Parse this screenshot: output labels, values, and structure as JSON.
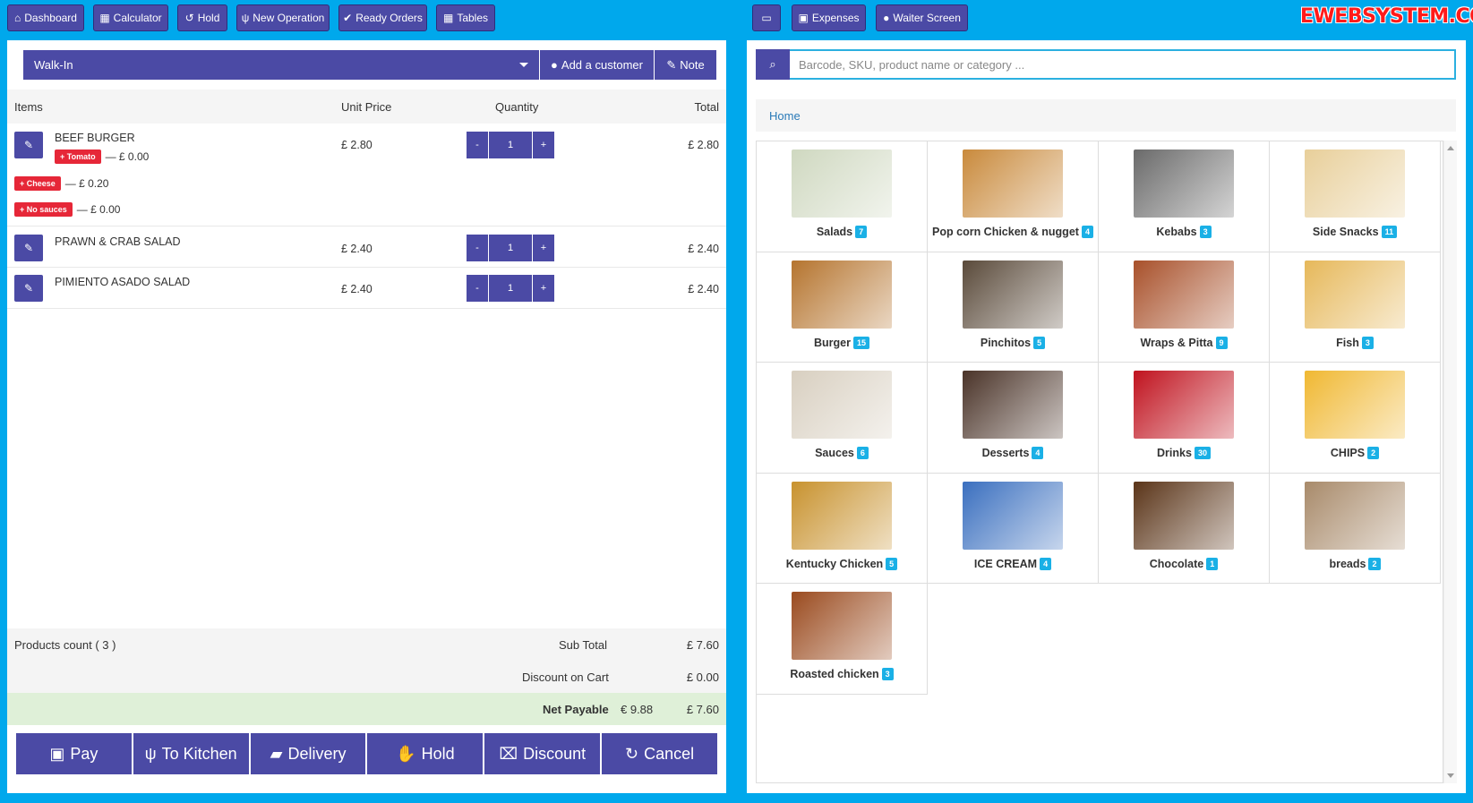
{
  "toolbar": {
    "dashboard": "Dashboard",
    "calculator": "Calculator",
    "hold": "Hold",
    "new_operation": "New Operation",
    "ready_orders": "Ready Orders",
    "tables": "Tables",
    "expenses": "Expenses",
    "waiter_screen": "Waiter Screen"
  },
  "brand": "EWEBSYSTEM.COM",
  "customer": {
    "selected": "Walk-In",
    "add_label": "Add a customer",
    "note_label": "Note"
  },
  "cart": {
    "headers": {
      "items": "Items",
      "unit_price": "Unit Price",
      "quantity": "Quantity",
      "total": "Total"
    },
    "items": [
      {
        "name": "BEEF BURGER",
        "unit_price": "£ 2.80",
        "qty": "1",
        "total": "£ 2.80",
        "modifiers": [
          {
            "label": "+ Tomato",
            "price": "— £ 0.00"
          },
          {
            "label": "+ Cheese",
            "price": "— £ 0.20"
          },
          {
            "label": "+ No sauces",
            "price": "— £ 0.00"
          }
        ]
      },
      {
        "name": "PRAWN & CRAB SALAD",
        "unit_price": "£ 2.40",
        "qty": "1",
        "total": "£ 2.40"
      },
      {
        "name": "PIMIENTO ASADO SALAD",
        "unit_price": "£ 2.40",
        "qty": "1",
        "total": "£ 2.40"
      }
    ],
    "minus": "-",
    "plus": "+"
  },
  "summary": {
    "products_count": "Products count ( 3 )",
    "subtotal_label": "Sub Total",
    "subtotal": "£ 7.60",
    "discount_label": "Discount on Cart",
    "discount": "£ 0.00",
    "net_label": "Net Payable",
    "net_eur": "€ 9.88",
    "net": "£ 7.60"
  },
  "actions": {
    "pay": "Pay",
    "kitchen": "To Kitchen",
    "delivery": "Delivery",
    "hold": "Hold",
    "discount": "Discount",
    "cancel": "Cancel"
  },
  "search": {
    "placeholder": "Barcode, SKU, product name or category ..."
  },
  "breadcrumb": "Home",
  "categories": [
    {
      "name": "Salads",
      "count": "7",
      "color": "#cfd8c0"
    },
    {
      "name": "Pop corn Chicken & nugget",
      "count": "4",
      "color": "#c98a3c"
    },
    {
      "name": "Kebabs",
      "count": "3",
      "color": "#6a6a6a"
    },
    {
      "name": "Side Snacks",
      "count": "11",
      "color": "#e8cf9a"
    },
    {
      "name": "Burger",
      "count": "15",
      "color": "#b5742e"
    },
    {
      "name": "Pinchitos",
      "count": "5",
      "color": "#5a4a3a"
    },
    {
      "name": "Wraps & Pitta",
      "count": "9",
      "color": "#a8502a"
    },
    {
      "name": "Fish",
      "count": "3",
      "color": "#e6b85a"
    },
    {
      "name": "Sauces",
      "count": "6",
      "color": "#d8cfc0"
    },
    {
      "name": "Desserts",
      "count": "4",
      "color": "#4a3328"
    },
    {
      "name": "Drinks",
      "count": "30",
      "color": "#c0121e"
    },
    {
      "name": "CHIPS",
      "count": "2",
      "color": "#f0b832"
    },
    {
      "name": "Kentucky Chicken",
      "count": "5",
      "color": "#c8922e"
    },
    {
      "name": "ICE CREAM",
      "count": "4",
      "color": "#3a6fbf"
    },
    {
      "name": "Chocolate",
      "count": "1",
      "color": "#5a3418"
    },
    {
      "name": "breads",
      "count": "2",
      "color": "#a88a6a"
    },
    {
      "name": "Roasted chicken",
      "count": "3",
      "color": "#9a4a1e"
    }
  ]
}
